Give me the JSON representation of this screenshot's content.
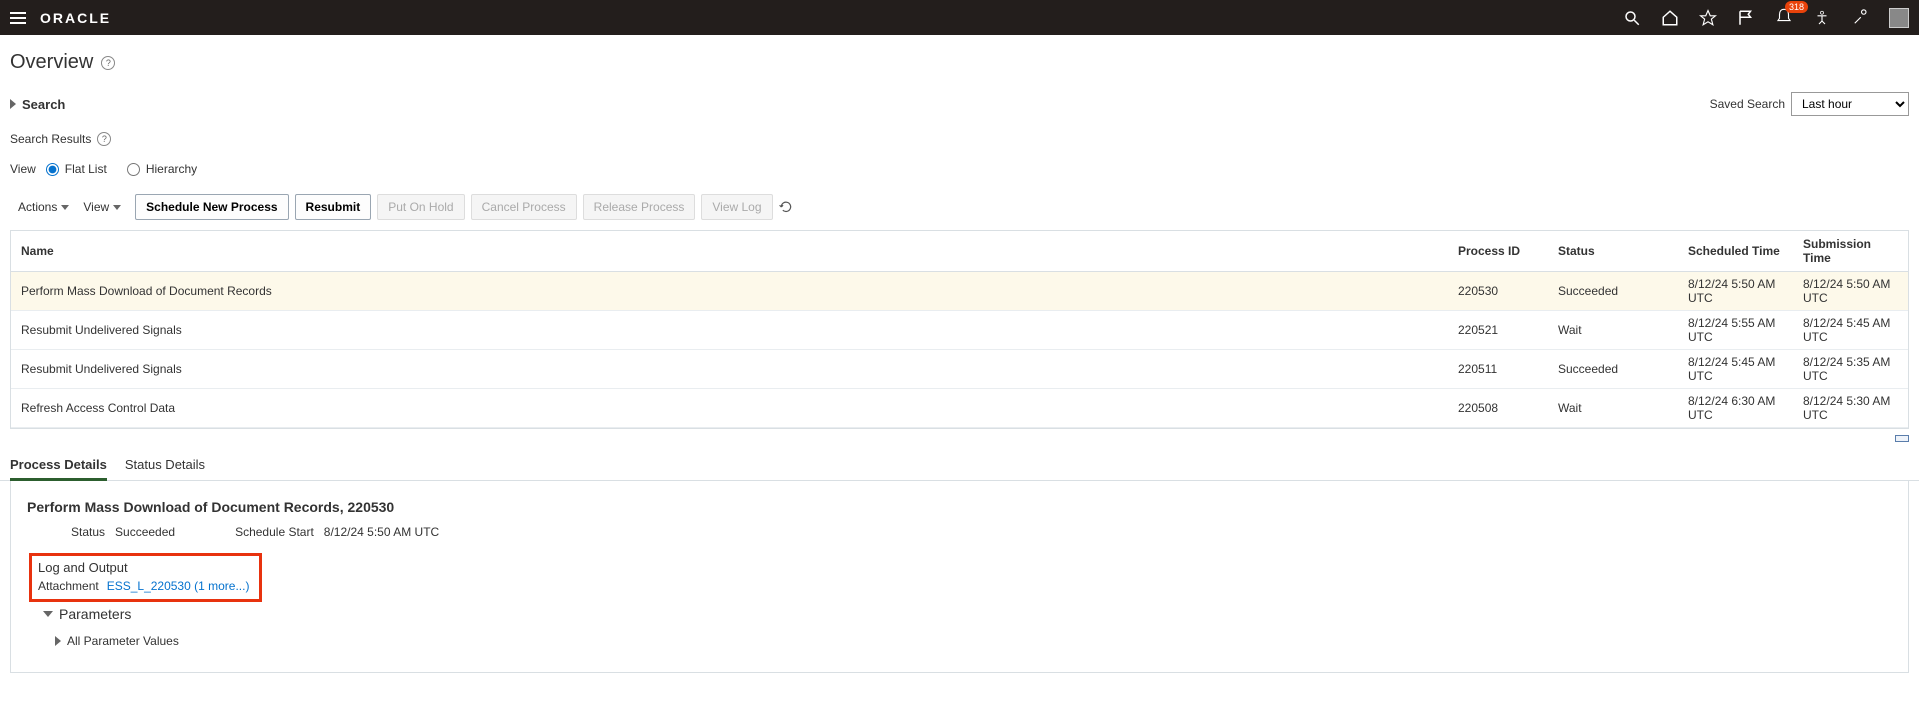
{
  "header": {
    "logo": "ORACLE",
    "notification_count": "318"
  },
  "page": {
    "title": "Overview"
  },
  "search": {
    "label": "Search",
    "saved_label": "Saved Search",
    "saved_value": "Last hour"
  },
  "results": {
    "header": "Search Results",
    "view_label": "View",
    "flat_label": "Flat List",
    "hierarchy_label": "Hierarchy"
  },
  "toolbar": {
    "actions": "Actions",
    "view": "View",
    "schedule": "Schedule New Process",
    "resubmit": "Resubmit",
    "put_on_hold": "Put On Hold",
    "cancel": "Cancel Process",
    "release": "Release Process",
    "view_log": "View Log"
  },
  "columns": {
    "name": "Name",
    "process_id": "Process ID",
    "status": "Status",
    "scheduled": "Scheduled Time",
    "submission": "Submission Time"
  },
  "rows": [
    {
      "name": "Perform Mass Download of Document Records",
      "pid": "220530",
      "status": "Succeeded",
      "scheduled": "8/12/24 5:50 AM UTC",
      "submission": "8/12/24 5:50 AM UTC"
    },
    {
      "name": "Resubmit Undelivered Signals",
      "pid": "220521",
      "status": "Wait",
      "scheduled": "8/12/24 5:55 AM UTC",
      "submission": "8/12/24 5:45 AM UTC"
    },
    {
      "name": "Resubmit Undelivered Signals",
      "pid": "220511",
      "status": "Succeeded",
      "scheduled": "8/12/24 5:45 AM UTC",
      "submission": "8/12/24 5:35 AM UTC"
    },
    {
      "name": "Refresh Access Control Data",
      "pid": "220508",
      "status": "Wait",
      "scheduled": "8/12/24 6:30 AM UTC",
      "submission": "8/12/24 5:30 AM UTC"
    }
  ],
  "tabs": {
    "process_details": "Process Details",
    "status_details": "Status Details"
  },
  "details": {
    "title": "Perform Mass Download of Document Records, 220530",
    "status_label": "Status",
    "status_value": "Succeeded",
    "schedule_label": "Schedule Start",
    "schedule_value": "8/12/24 5:50 AM UTC",
    "log_output_title": "Log and Output",
    "attachment_label": "Attachment",
    "attachment_link": "ESS_L_220530 (1 more...)",
    "parameters": "Parameters",
    "all_params": "All Parameter Values"
  }
}
